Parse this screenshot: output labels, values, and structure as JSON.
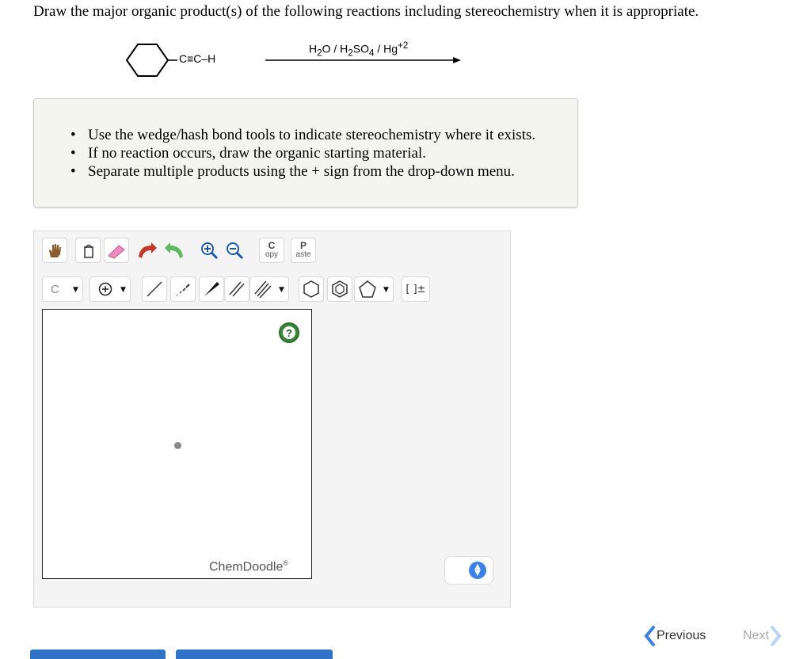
{
  "question": {
    "text": "Draw the major organic product(s) of the following reactions including stereochemistry when it is appropriate."
  },
  "reaction": {
    "substituent": "C≡C–H",
    "reagent": {
      "part1": "H",
      "sub1": "2",
      "part2": "O / H",
      "sub2": "2",
      "part3": "SO",
      "sub3": "4",
      "part4": " / Hg",
      "sup1": "+2"
    }
  },
  "instructions": [
    "Use the wedge/hash bond tools to indicate stereochemistry where it exists.",
    "If no reaction occurs, draw the organic starting material.",
    "Separate multiple products using the + sign from the drop-down menu."
  ],
  "toolbar": {
    "copy_big": "C",
    "copy_small": "opy",
    "paste_big": "P",
    "paste_small": "aste",
    "atom_label": "C",
    "bracket_label": "[ ]±"
  },
  "canvas": {
    "help": "?",
    "brand": "ChemDoodle",
    "brand_mark": "®"
  },
  "nav": {
    "previous": "Previous",
    "next": "Next"
  },
  "colors": {
    "accent": "#3b82e6",
    "help_green": "#3a8a3a",
    "eraser_pink": "#f08cbf",
    "undo_red": "#c0392b",
    "redo_green": "#5fb85f"
  }
}
